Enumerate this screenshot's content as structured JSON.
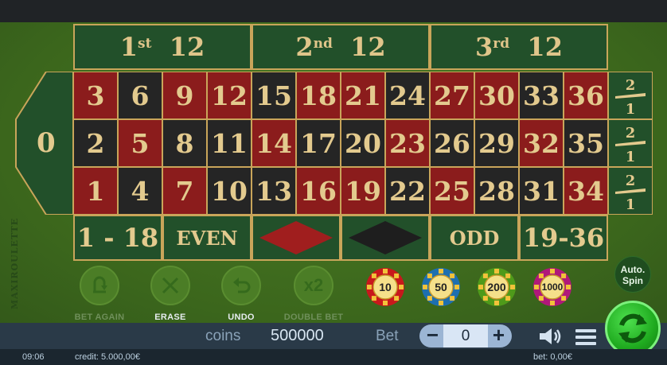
{
  "dozens": [
    {
      "ord": "1",
      "sup": "st",
      "num": "12"
    },
    {
      "ord": "2",
      "sup": "nd",
      "num": "12"
    },
    {
      "ord": "3",
      "sup": "rd",
      "num": "12"
    }
  ],
  "zero": "0",
  "rows": [
    [
      {
        "n": "3",
        "c": "red"
      },
      {
        "n": "6",
        "c": "black"
      },
      {
        "n": "9",
        "c": "red"
      },
      {
        "n": "12",
        "c": "red"
      },
      {
        "n": "15",
        "c": "black"
      },
      {
        "n": "18",
        "c": "red"
      },
      {
        "n": "21",
        "c": "red"
      },
      {
        "n": "24",
        "c": "black"
      },
      {
        "n": "27",
        "c": "red"
      },
      {
        "n": "30",
        "c": "red"
      },
      {
        "n": "33",
        "c": "black"
      },
      {
        "n": "36",
        "c": "red"
      }
    ],
    [
      {
        "n": "2",
        "c": "black"
      },
      {
        "n": "5",
        "c": "red"
      },
      {
        "n": "8",
        "c": "black"
      },
      {
        "n": "11",
        "c": "black"
      },
      {
        "n": "14",
        "c": "red"
      },
      {
        "n": "17",
        "c": "black"
      },
      {
        "n": "20",
        "c": "black"
      },
      {
        "n": "23",
        "c": "red"
      },
      {
        "n": "26",
        "c": "black"
      },
      {
        "n": "29",
        "c": "black"
      },
      {
        "n": "32",
        "c": "red"
      },
      {
        "n": "35",
        "c": "black"
      }
    ],
    [
      {
        "n": "1",
        "c": "red"
      },
      {
        "n": "4",
        "c": "black"
      },
      {
        "n": "7",
        "c": "red"
      },
      {
        "n": "10",
        "c": "black"
      },
      {
        "n": "13",
        "c": "black"
      },
      {
        "n": "16",
        "c": "red"
      },
      {
        "n": "19",
        "c": "red"
      },
      {
        "n": "22",
        "c": "black"
      },
      {
        "n": "25",
        "c": "red"
      },
      {
        "n": "28",
        "c": "black"
      },
      {
        "n": "31",
        "c": "black"
      },
      {
        "n": "34",
        "c": "red"
      }
    ]
  ],
  "column_bet": {
    "top": "2",
    "bottom": "1"
  },
  "outside": {
    "low": "1 - 18",
    "even": "EVEN",
    "odd": "ODD",
    "high": "19-36"
  },
  "side_label": "MAXIROULETTE",
  "controls": {
    "bet_again": "BET AGAIN",
    "erase": "ERASE",
    "undo": "UNDO",
    "double_bet": "DOUBLE BET",
    "double_icon": "x2"
  },
  "chips": [
    {
      "value": "10",
      "color": "#c8181c"
    },
    {
      "value": "50",
      "color": "#1e6fb0"
    },
    {
      "value": "200",
      "color": "#4f9a1a"
    },
    {
      "value": "1000",
      "color": "#b0187a"
    }
  ],
  "auto_spin": {
    "line1": "Auto.",
    "line2": "Spin"
  },
  "bar": {
    "coins_label": "coins",
    "coins_value": "500000",
    "bet_label": "Bet",
    "bet_value": "0",
    "minus": "−",
    "plus": "+"
  },
  "status": {
    "time": "09:06",
    "credit": "credit: 5.000,00€",
    "bet": "bet: 0,00€"
  },
  "colors": {
    "red": "#8b1c1c",
    "black": "#252525",
    "gold": "#c9a55a",
    "felt": "#3f6b1f",
    "spin": "#1faa1f"
  },
  "icons": [
    "bet-again-icon",
    "erase-icon",
    "undo-icon",
    "speaker-icon",
    "menu-icon",
    "spin-icon",
    "diamond-red-icon",
    "diamond-black-icon"
  ]
}
